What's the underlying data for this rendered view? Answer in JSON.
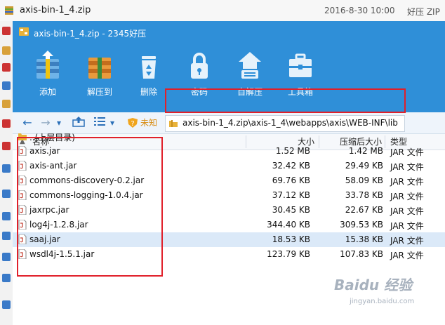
{
  "background_item": {
    "filename": "axis-bin-1_4.zip",
    "date": "2016-8-30 10:00",
    "type": "好压 ZIP"
  },
  "window": {
    "title": "axis-bin-1_4.zip - 2345好压"
  },
  "toolbar": {
    "add": "添加",
    "extract_to": "解压到",
    "delete": "删除",
    "password": "密码",
    "self_extract": "自解压",
    "toolbox": "工具箱"
  },
  "nav": {
    "back": "←",
    "forward": "→",
    "dropdown": "▾",
    "unknown_label": "未知",
    "path": "axis-bin-1_4.zip\\axis-1_4\\webapps\\axis\\WEB-INF\\lib"
  },
  "columns": {
    "name": "名称",
    "size": "大小",
    "compressed": "压缩后大小",
    "type": "类型"
  },
  "parent_dir": "..(上层目录)",
  "files": [
    {
      "name": "axis.jar",
      "size": "1.52 MB",
      "compressed": "1.42 MB",
      "type": "JAR 文件"
    },
    {
      "name": "axis-ant.jar",
      "size": "32.42 KB",
      "compressed": "29.49 KB",
      "type": "JAR 文件"
    },
    {
      "name": "commons-discovery-0.2.jar",
      "size": "69.76 KB",
      "compressed": "58.09 KB",
      "type": "JAR 文件"
    },
    {
      "name": "commons-logging-1.0.4.jar",
      "size": "37.12 KB",
      "compressed": "33.78 KB",
      "type": "JAR 文件"
    },
    {
      "name": "jaxrpc.jar",
      "size": "30.45 KB",
      "compressed": "22.67 KB",
      "type": "JAR 文件"
    },
    {
      "name": "log4j-1.2.8.jar",
      "size": "344.40 KB",
      "compressed": "309.53 KB",
      "type": "JAR 文件"
    },
    {
      "name": "saaj.jar",
      "size": "18.53 KB",
      "compressed": "15.38 KB",
      "type": "JAR 文件"
    },
    {
      "name": "wsdl4j-1.5.1.jar",
      "size": "123.79 KB",
      "compressed": "107.83 KB",
      "type": "JAR 文件"
    }
  ],
  "watermark": {
    "line1": "Baidu 经验",
    "line2": "jingyan.baidu.com"
  },
  "colors": {
    "accent": "#2f8fd8",
    "highlight": "#e0202a",
    "selected_row": "#dbe9f8"
  }
}
